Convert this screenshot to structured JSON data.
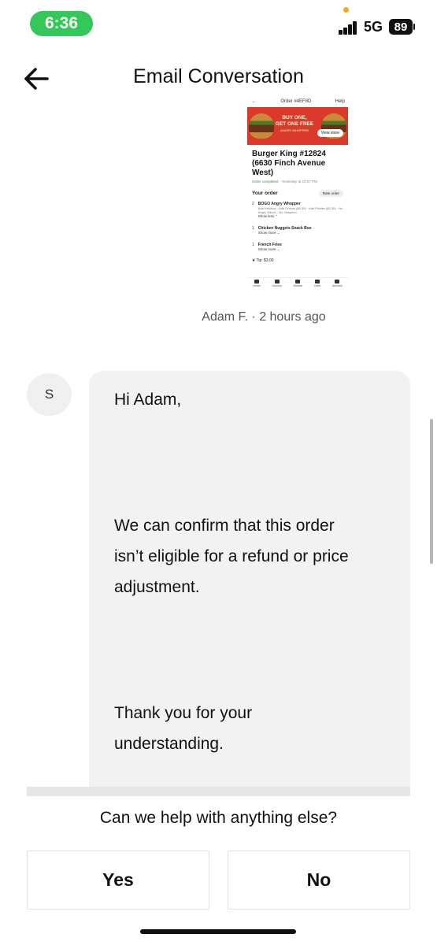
{
  "status_bar": {
    "time": "6:36",
    "network": "5G",
    "battery": "89"
  },
  "header": {
    "title": "Email Conversation"
  },
  "attachment": {
    "top_left": "Order #4EF8D",
    "top_right": "Help",
    "promo_line1": "BUY ONE,",
    "promo_line2": "GET ONE FREE",
    "promo_sub": "ANGRY WHOPPER",
    "view_store": "View store",
    "store_name": "Burger King #12824 (6630 Finch Avenue West)",
    "order_status": "Order completed",
    "order_time": "· Yesterday at 10:07 PM",
    "your_order": "Your order",
    "rate_order": "Rate order",
    "items": [
      {
        "qty": "2",
        "name": "BOGO Angry Whopper",
        "detail": "Add Ketchup · Add Onions ($0.30) · Add Pickles ($0.30) · No Angry Sauce · No Jalapeno",
        "toggle": "Show less ⌃"
      },
      {
        "qty": "1",
        "name": "Chicken Nuggets Snack Box",
        "detail": "",
        "toggle": "Show more ⌄"
      },
      {
        "qty": "1",
        "name": "French Fries",
        "detail": "",
        "toggle": "Show more ⌄"
      }
    ],
    "tip": "Tip: $3.00",
    "nav": [
      "Home",
      "Grocery",
      "Browse",
      "Carts",
      "Account"
    ]
  },
  "attachment_meta": "Adam F. · 2 hours ago",
  "message": {
    "avatar_initial": "S",
    "lines": [
      "Hi Adam,",
      "We can confirm that this order",
      "isn’t eligible for a refund or price",
      "adjustment.",
      "Thank you for your",
      "understanding."
    ]
  },
  "prompt": {
    "question": "Can we help with anything else?",
    "yes_label": "Yes",
    "no_label": "No"
  },
  "colors": {
    "time_pill": "#34c759",
    "bubble": "#f2f2f2",
    "banner": "#d93a2b"
  }
}
